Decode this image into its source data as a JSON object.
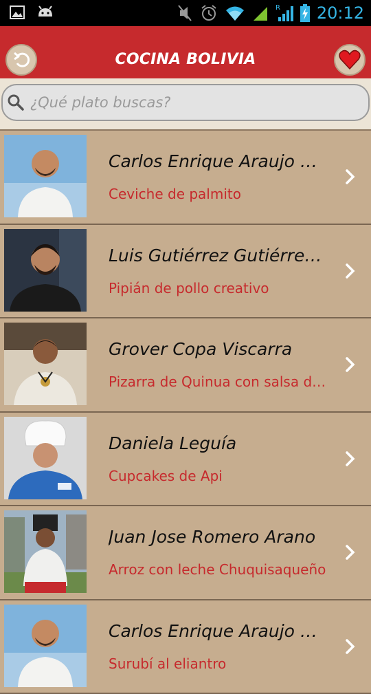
{
  "status_bar": {
    "time": "20:12",
    "icons": [
      "image-icon",
      "android-icon",
      "mute-icon",
      "alarm-icon",
      "wifi-icon",
      "signal-icon",
      "roaming-signal-icon",
      "battery-charging-icon"
    ]
  },
  "header": {
    "title": "COCINA BOLIVIA",
    "back_icon": "back-arrow-icon",
    "fav_icon": "heart-icon"
  },
  "search": {
    "placeholder": "¿Qué plato buscas?",
    "value": ""
  },
  "recipes": [
    {
      "chef": "Carlos Enrique Araujo Urquizo",
      "dish": "Ceviche de palmito"
    },
    {
      "chef": "Luis Gutiérrez Gutiérrez Gutiérrez",
      "dish": "Pipián de pollo creativo"
    },
    {
      "chef": "Grover Copa Viscarra",
      "dish": "Pizarra de Quinua con salsa de tamarindo"
    },
    {
      "chef": "Daniela Leguía",
      "dish": "Cupcakes de Api"
    },
    {
      "chef": "Juan Jose Romero Arano",
      "dish": "Arroz con leche Chuquisaqueño"
    },
    {
      "chef": "Carlos Enrique Araujo Urquizo",
      "dish": "Surubí al eliantro"
    }
  ],
  "colors": {
    "header": "#c62a2d",
    "list_bg": "#c6ad8f",
    "dish_text": "#c62a2d",
    "status_icons": "#35b5e5"
  }
}
